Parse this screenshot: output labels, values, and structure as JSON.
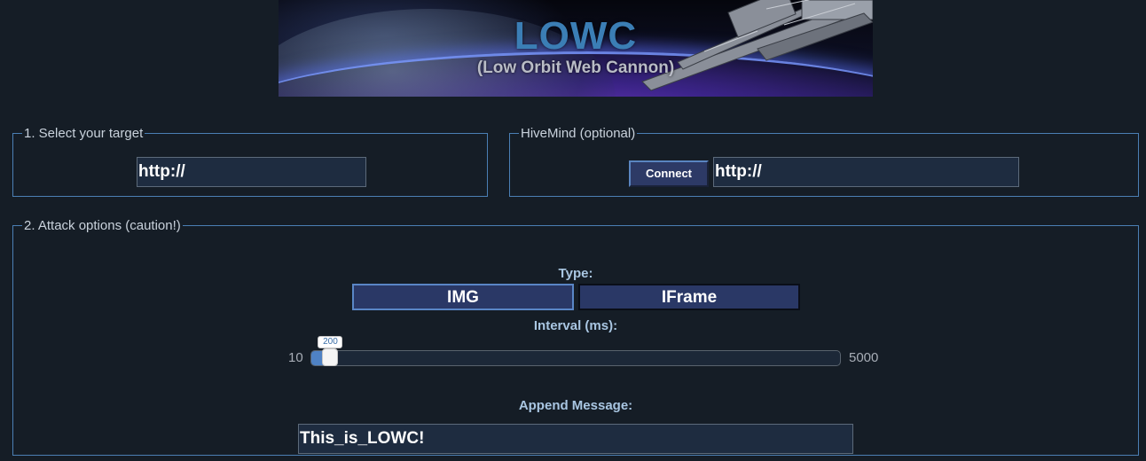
{
  "banner": {
    "title": "LOWC",
    "subtitle": "(Low Orbit Web Cannon)"
  },
  "target": {
    "legend": "1. Select your target",
    "url_value": "http://"
  },
  "hivemind": {
    "legend": "HiveMind (optional)",
    "connect_label": "Connect",
    "url_value": "http://"
  },
  "attack": {
    "legend": "2. Attack options (caution!)",
    "type_label": "Type:",
    "type_options": [
      "IMG",
      "IFrame"
    ],
    "selected_type": "IMG",
    "interval_label": "Interval (ms):",
    "interval_min": "10",
    "interval_max": "5000",
    "interval_value": "200",
    "interval_fraction": 0.036,
    "append_label": "Append Message:",
    "append_value": "This_is_LOWC!"
  },
  "colors": {
    "background": "#151d26",
    "border_accent": "#4b7fb4",
    "title_blue": "#3b7eb5",
    "button_fill": "#2a3866",
    "label_blue": "#a9c6e2"
  }
}
